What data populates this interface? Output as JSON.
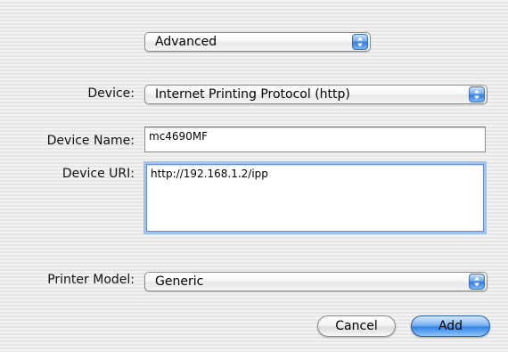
{
  "mode_popup": {
    "selected": "Advanced"
  },
  "device": {
    "label": "Device:",
    "selected": "Internet Printing Protocol (http)"
  },
  "device_name": {
    "label": "Device Name:",
    "value": "mc4690MF"
  },
  "device_uri": {
    "label": "Device URI:",
    "value": "http://192.168.1.2/ipp"
  },
  "printer_model": {
    "label": "Printer Model:",
    "selected": "Generic"
  },
  "buttons": {
    "cancel": "Cancel",
    "add": "Add"
  },
  "icons": {
    "popup_arrows": "up-down-arrows-icon"
  },
  "colors": {
    "accent": "#3485e6",
    "focus_ring": "#9ec3f1"
  }
}
